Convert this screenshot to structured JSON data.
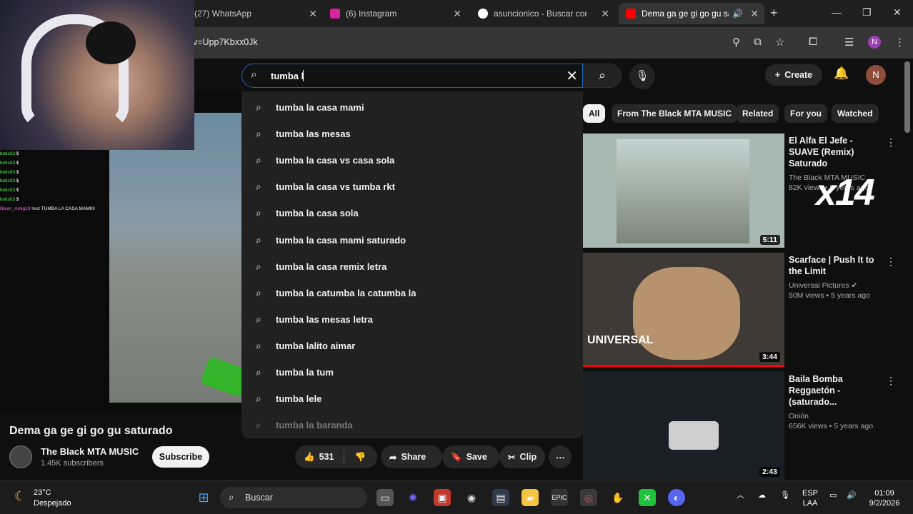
{
  "browser": {
    "tabs": [
      {
        "label": "(27) WhatsApp",
        "favicon": "whatsapp-icon",
        "color": "#25d366"
      },
      {
        "label": "(6) Instagram",
        "favicon": "instagram-icon",
        "color": "#d6249f"
      },
      {
        "label": "asuncionico - Buscar con Go",
        "favicon": "google-icon",
        "color": "#4285f4"
      },
      {
        "label": "Dema ga ge gi go gu sat",
        "favicon": "youtube-icon",
        "color": "#ff0000"
      }
    ],
    "url": "v=Upp7Kbxx0Jk",
    "profile_initial": "N"
  },
  "youtube": {
    "search_value": "tumba l",
    "create_label": "Create",
    "avatar_initial": "N"
  },
  "suggestions": [
    "tumba la casa mami",
    "tumba las mesas",
    "tumba la casa vs casa sola",
    "tumba la casa vs tumba rkt",
    "tumba la casa sola",
    "tumba la casa mami saturado",
    "tumba la casa remix letra",
    "tumba la catumba la catumba la",
    "tumba las mesas letra",
    "tumba lalito aimar",
    "tumba la tum",
    "tumba lele",
    "tumba la baranda"
  ],
  "chat": [
    {
      "name": "botis03",
      "text": "$"
    },
    {
      "name": "botis03",
      "text": "$"
    },
    {
      "name": "botis03",
      "text": "$"
    },
    {
      "name": "botis03",
      "text": "$"
    },
    {
      "name": "botis03",
      "text": "$"
    },
    {
      "name": "botis03",
      "text": "$"
    },
    {
      "name": "Nixon_Amig19",
      "text": "!voz TUMBA LA CASA MAMIIII"
    }
  ],
  "video": {
    "title": "Dema ga ge gi go gu saturado",
    "channel": "The Black MTA MUSIC",
    "subscribers": "1.45K subscribers",
    "subscribe_label": "Subscribe",
    "likes": "531",
    "share_label": "Share",
    "save_label": "Save",
    "clip_label": "Clip"
  },
  "chips": [
    "All",
    "From The Black MTA MUSIC",
    "Related",
    "For you",
    "Watched"
  ],
  "related": [
    {
      "title": "El Alfa El Jefe - SUAVE (Remix) Saturado",
      "channel": "The Black MTA MUSIC",
      "meta": "82K views • 5 years ago",
      "duration": "5:11",
      "overlay": "x14"
    },
    {
      "title": "Scarface | Push It to the Limit",
      "channel": "Universal Pictures",
      "meta": "50M views • 5 years ago",
      "duration": "3:44",
      "badge": "UNIVERSAL"
    },
    {
      "title": "Baila Bomba Reggaetón - (saturado...",
      "channel": "Onión",
      "meta": "656K views • 5 years ago",
      "duration": "2:43"
    }
  ],
  "taskbar": {
    "temperature": "23°C",
    "weather": "Despejado",
    "search_label": "Buscar",
    "lang_top": "ESP",
    "lang_bottom": "LAA",
    "time": "01:09",
    "date": "9/2/2026"
  }
}
